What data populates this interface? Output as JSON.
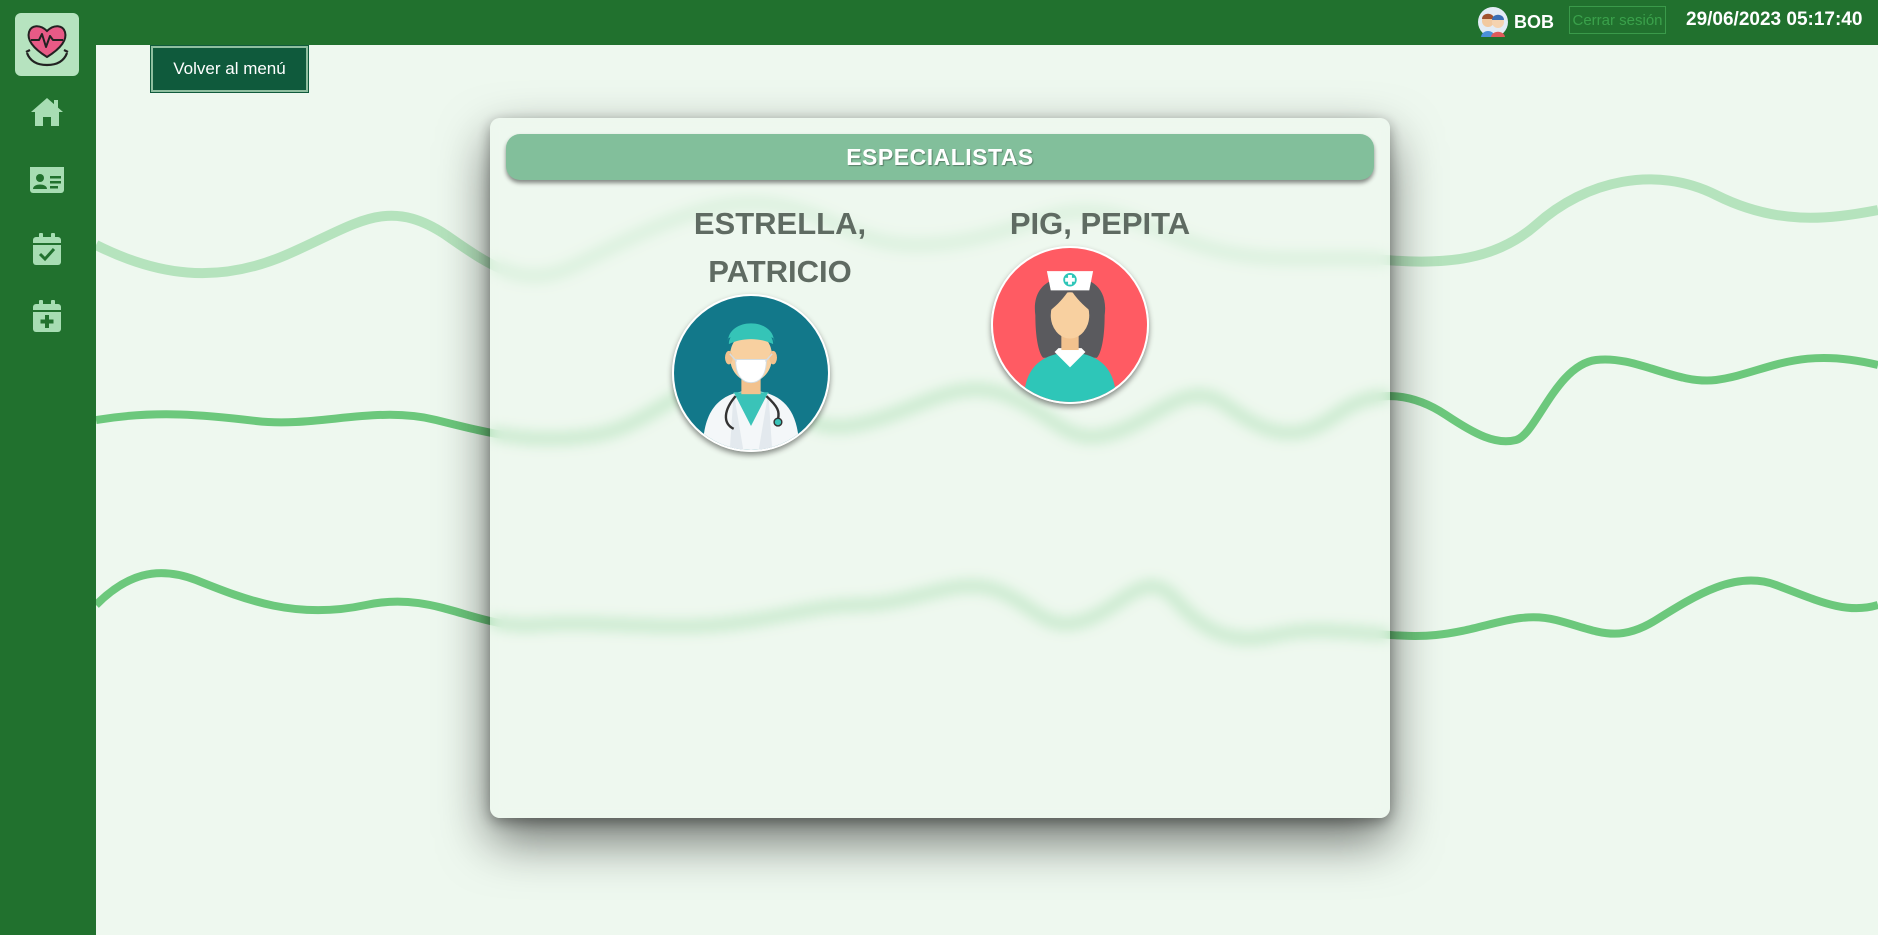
{
  "header": {
    "user_name": "BOB",
    "user_avatar_icon": "user-avatar-icon",
    "logout_label": "Cerrar sesión",
    "datetime": "29/06/2023 05:17:40"
  },
  "sidebar": {
    "logo_icon": "heart-hands-logo-icon",
    "items": [
      {
        "icon": "home-icon"
      },
      {
        "icon": "id-card-icon"
      },
      {
        "icon": "calendar-check-icon"
      },
      {
        "icon": "calendar-plus-icon"
      }
    ]
  },
  "main": {
    "back_button_label": "Volver al menú",
    "panel_title": "ESPECIALISTAS",
    "specialists": [
      {
        "name": "ESTRELLA, PATRICIO",
        "avatar_icon": "doctor-icon"
      },
      {
        "name": "PIG, PEPITA",
        "avatar_icon": "nurse-icon"
      }
    ]
  },
  "colors": {
    "sidebar": "#21712e",
    "background": "#eef8ef",
    "panel_header": "#82bf9b",
    "back_button": "#0f5a3c",
    "wave_light": "#b5e3bd",
    "wave_medium": "#6cc87c",
    "doctor_bg": "#12788a",
    "nurse_bg": "#ff5b63"
  }
}
